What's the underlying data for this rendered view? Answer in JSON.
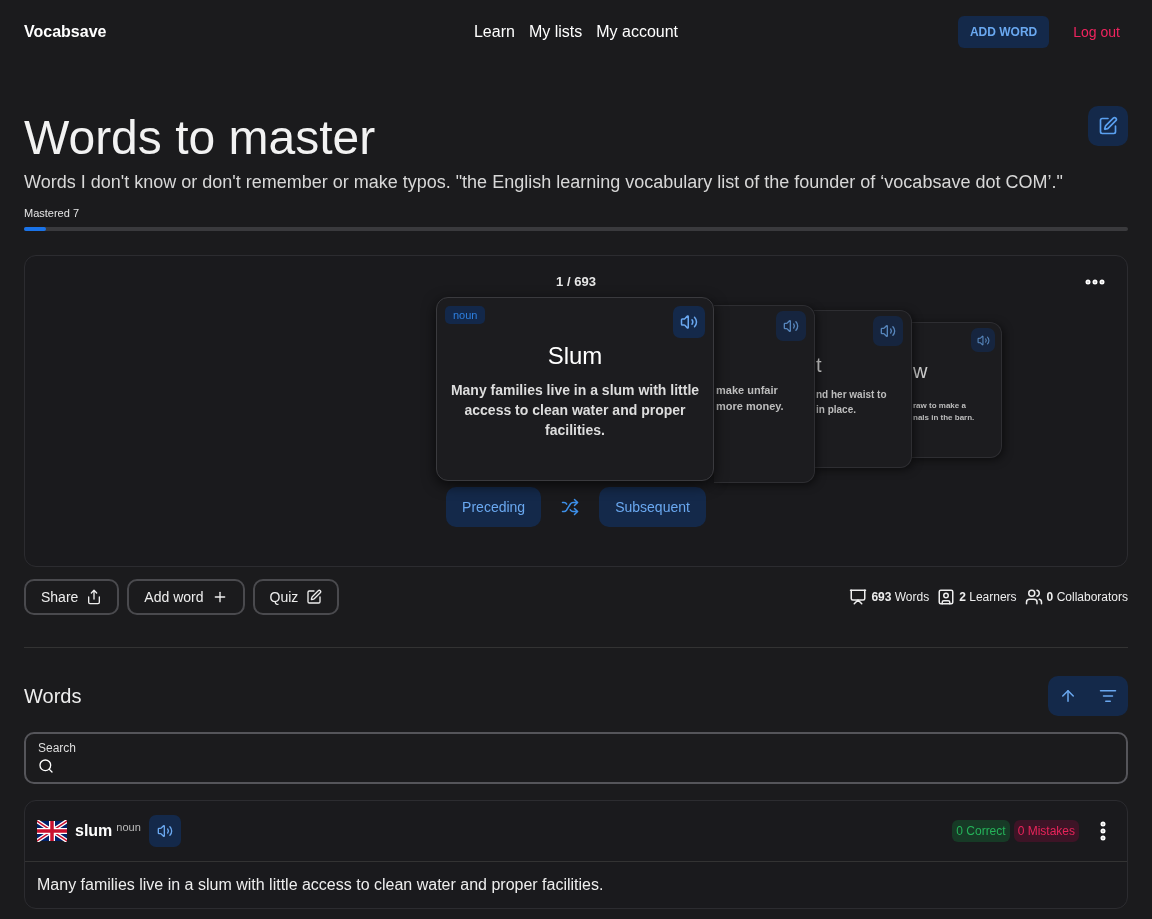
{
  "nav": {
    "brand": "Vocabsave",
    "links": [
      "Learn",
      "My lists",
      "My account"
    ],
    "add_button": "ADD WORD",
    "logout": "Log out"
  },
  "list": {
    "title": "Words to master",
    "description": "Words I don't know or don't remember or make typos. \"the English learning vocabulary list of the founder of ‘vocabsave dot COM’.\"",
    "mastered_label": "Mastered 7",
    "mastered": {
      "level": 0.02
    }
  },
  "carousel": {
    "counter": "1 / 693",
    "front_card": {
      "tag": "noun",
      "word": "Slum",
      "sentence": "Many families live in a slum with little access to clean water and proper facilities."
    },
    "back_cards": [
      {
        "lines": [
          "make unfair",
          "more money."
        ]
      },
      {
        "word": "t",
        "lines": [
          "nd her waist to",
          "in place."
        ]
      },
      {
        "word": "w",
        "lines": [
          "raw to make a",
          "nals in the barn."
        ]
      }
    ],
    "prev": "Preceding",
    "next": "Subsequent"
  },
  "actions": [
    "Share",
    "Add word",
    "Quiz"
  ],
  "stats": [
    "**693** Words",
    "**2** Learners",
    "**0** Collaborators"
  ],
  "words_section": {
    "title": "Words",
    "search": {
      "label": "Search"
    }
  },
  "entries": [
    {
      "word": "slum",
      "pos": "noun",
      "correct": "0 Correct",
      "mistakes": "0 Mistakes",
      "sentence": "Many families live in a slum with little access to clean water and proper facilities."
    }
  ]
}
